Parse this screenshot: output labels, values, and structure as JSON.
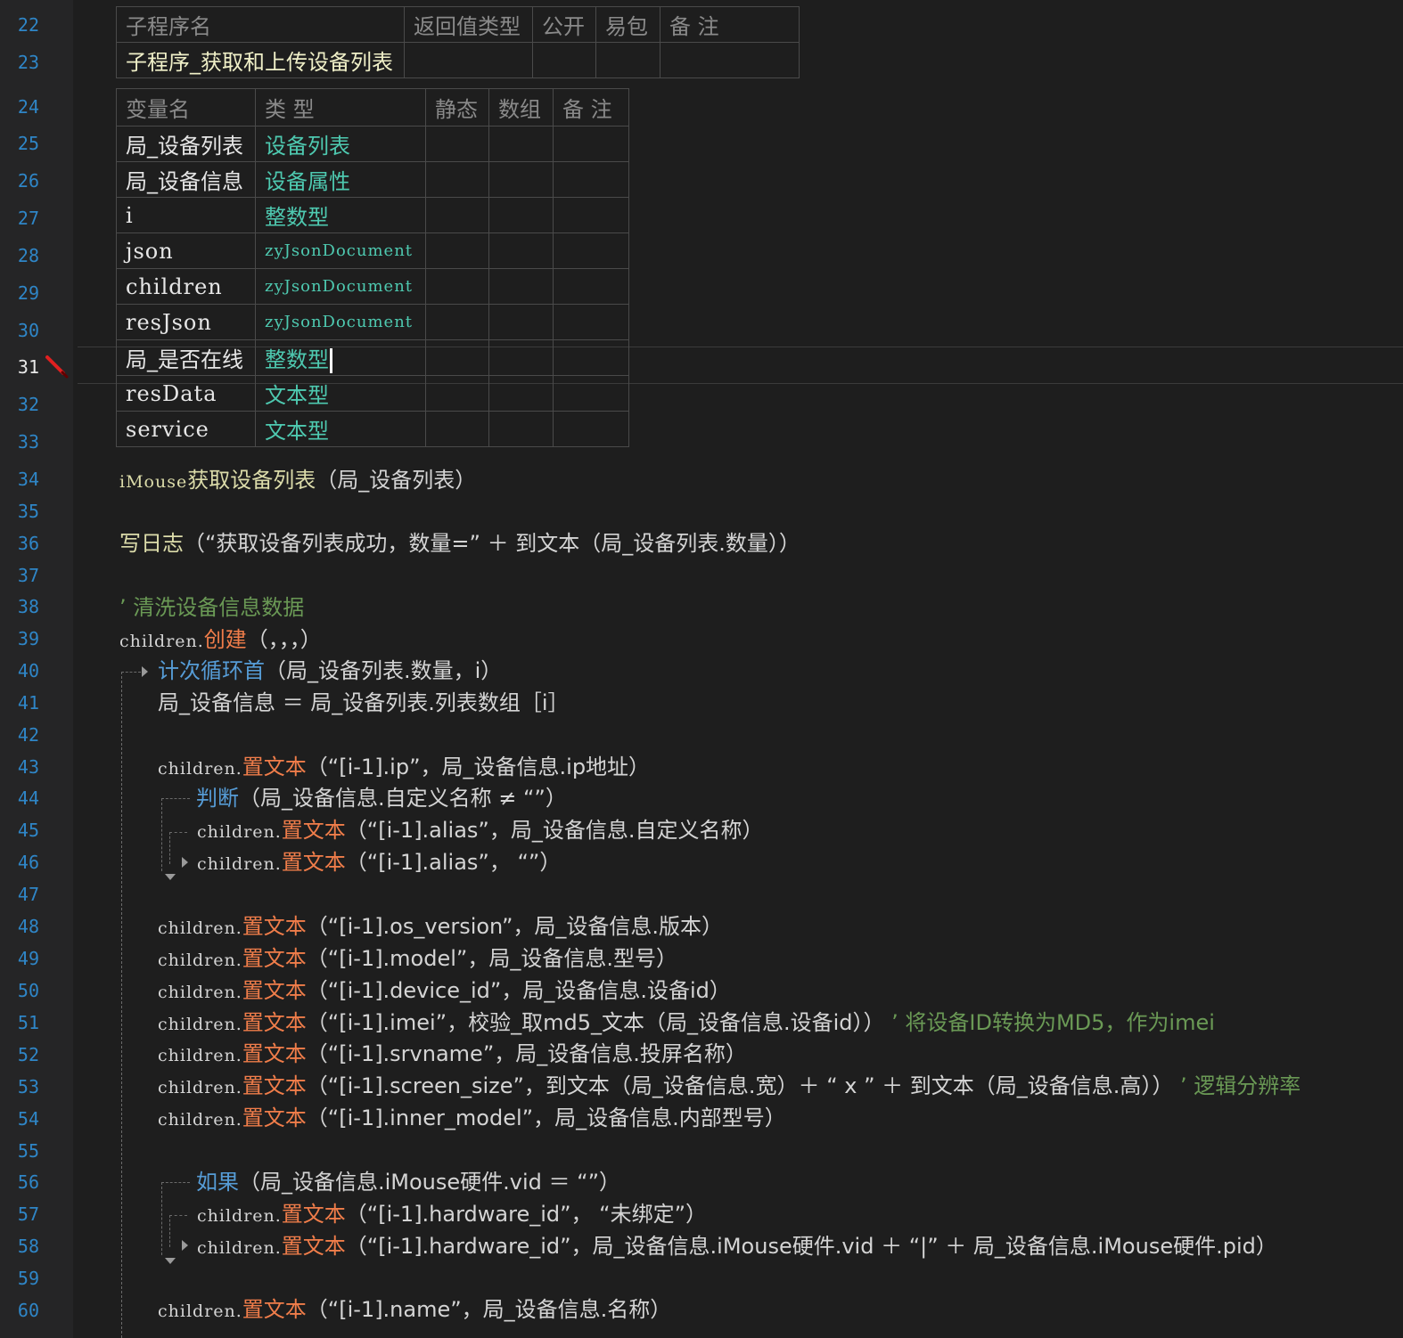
{
  "editor": {
    "line_numbers": [
      "22",
      "23",
      "24",
      "25",
      "26",
      "27",
      "28",
      "29",
      "30",
      "31",
      "32",
      "33",
      "34",
      "35",
      "36",
      "37",
      "38",
      "39",
      "40",
      "41",
      "42",
      "43",
      "44",
      "45",
      "46",
      "47",
      "48",
      "49",
      "50",
      "51",
      "52",
      "53",
      "54",
      "55",
      "56",
      "57",
      "58",
      "59",
      "60"
    ],
    "current_line": "31",
    "breakpoint_icon": "pencil-icon"
  },
  "sub_table": {
    "headers": [
      "子程序名",
      "返回值类型",
      "公开",
      "易包",
      "备 注"
    ],
    "row": [
      "子程序_获取和上传设备列表",
      "",
      "",
      "",
      ""
    ]
  },
  "var_table": {
    "headers": [
      "变量名",
      "类 型",
      "静态",
      "数组",
      "备 注"
    ],
    "rows": [
      {
        "name": "局_设备列表",
        "type": "设备列表"
      },
      {
        "name": "局_设备信息",
        "type": "设备属性"
      },
      {
        "name": "i",
        "type": "整数型"
      },
      {
        "name": "json",
        "type": "zyJsonDocument"
      },
      {
        "name": "children",
        "type": "zyJsonDocument"
      },
      {
        "name": "resJson",
        "type": "zyJsonDocument"
      },
      {
        "name": "局_是否在线",
        "type": "整数型"
      },
      {
        "name": "resData",
        "type": "文本型"
      },
      {
        "name": "service",
        "type": "文本型"
      }
    ]
  },
  "code": {
    "l34": {
      "a": "iMouse",
      "b": "获取设备列表",
      "c": "（局_设备列表）"
    },
    "l36": {
      "a": "写日志",
      "b": "（“获取设备列表成功，数量=” ＋ 到文本（局_设备列表.数量））"
    },
    "l38": {
      "a": "’ 清洗设备信息数据"
    },
    "l39": {
      "a": "children.",
      "b": "创建",
      "c": "（，，，）"
    },
    "l40": {
      "a": "计次循环首",
      "b": "（局_设备列表.数量，i）"
    },
    "l41": {
      "a": "局_设备信息 ＝ 局_设备列表.列表数组［i］"
    },
    "l43": {
      "a": "children.",
      "b": "置文本",
      "c": "（“[i-1].ip”，局_设备信息.ip地址）"
    },
    "l44": {
      "a": "判断",
      "b": "（局_设备信息.自定义名称 ≠ “”）"
    },
    "l45": {
      "a": "children.",
      "b": "置文本",
      "c": "（“[i-1].alias”，局_设备信息.自定义名称）"
    },
    "l46": {
      "a": "children.",
      "b": "置文本",
      "c": "（“[i-1].alias”， “”）"
    },
    "l48": {
      "a": "children.",
      "b": "置文本",
      "c": "（“[i-1].os_version”，局_设备信息.版本）"
    },
    "l49": {
      "a": "children.",
      "b": "置文本",
      "c": "（“[i-1].model”，局_设备信息.型号）"
    },
    "l50": {
      "a": "children.",
      "b": "置文本",
      "c": "（“[i-1].device_id”，局_设备信息.设备id）"
    },
    "l51": {
      "a": "children.",
      "b": "置文本",
      "c": "（“[i-1].imei”，校验_取md5_文本（局_设备信息.设备id））",
      "d": "’ 将设备ID转换为MD5，作为imei"
    },
    "l52": {
      "a": "children.",
      "b": "置文本",
      "c": "（“[i-1].srvname”，局_设备信息.投屏名称）"
    },
    "l53": {
      "a": "children.",
      "b": "置文本",
      "c": "（“[i-1].screen_size”，到文本（局_设备信息.宽）＋ “ x ” ＋ 到文本（局_设备信息.高））",
      "d": "’ 逻辑分辨率"
    },
    "l54": {
      "a": "children.",
      "b": "置文本",
      "c": "（“[i-1].inner_model”，局_设备信息.内部型号）"
    },
    "l56": {
      "a": "如果",
      "b": "（局_设备信息.iMouse硬件.vid ＝ “”）"
    },
    "l57": {
      "a": "children.",
      "b": "置文本",
      "c": "（“[i-1].hardware_id”， “未绑定”）"
    },
    "l58": {
      "a": "children.",
      "b": "置文本",
      "c": "（“[i-1].hardware_id”，局_设备信息.iMouse硬件.vid ＋ “|” ＋ 局_设备信息.iMouse硬件.pid）"
    },
    "l60": {
      "a": "children.",
      "b": "置文本",
      "c": "（“[i-1].name”，局_设备信息.名称）"
    }
  },
  "colors": {
    "background": "#1e1e1e",
    "gutter": "#252526",
    "line_number": "#2f86c7",
    "type": "#4ec9b0",
    "method": "#f07d4a",
    "keyword": "#569cd6",
    "comment": "#6a9955"
  }
}
